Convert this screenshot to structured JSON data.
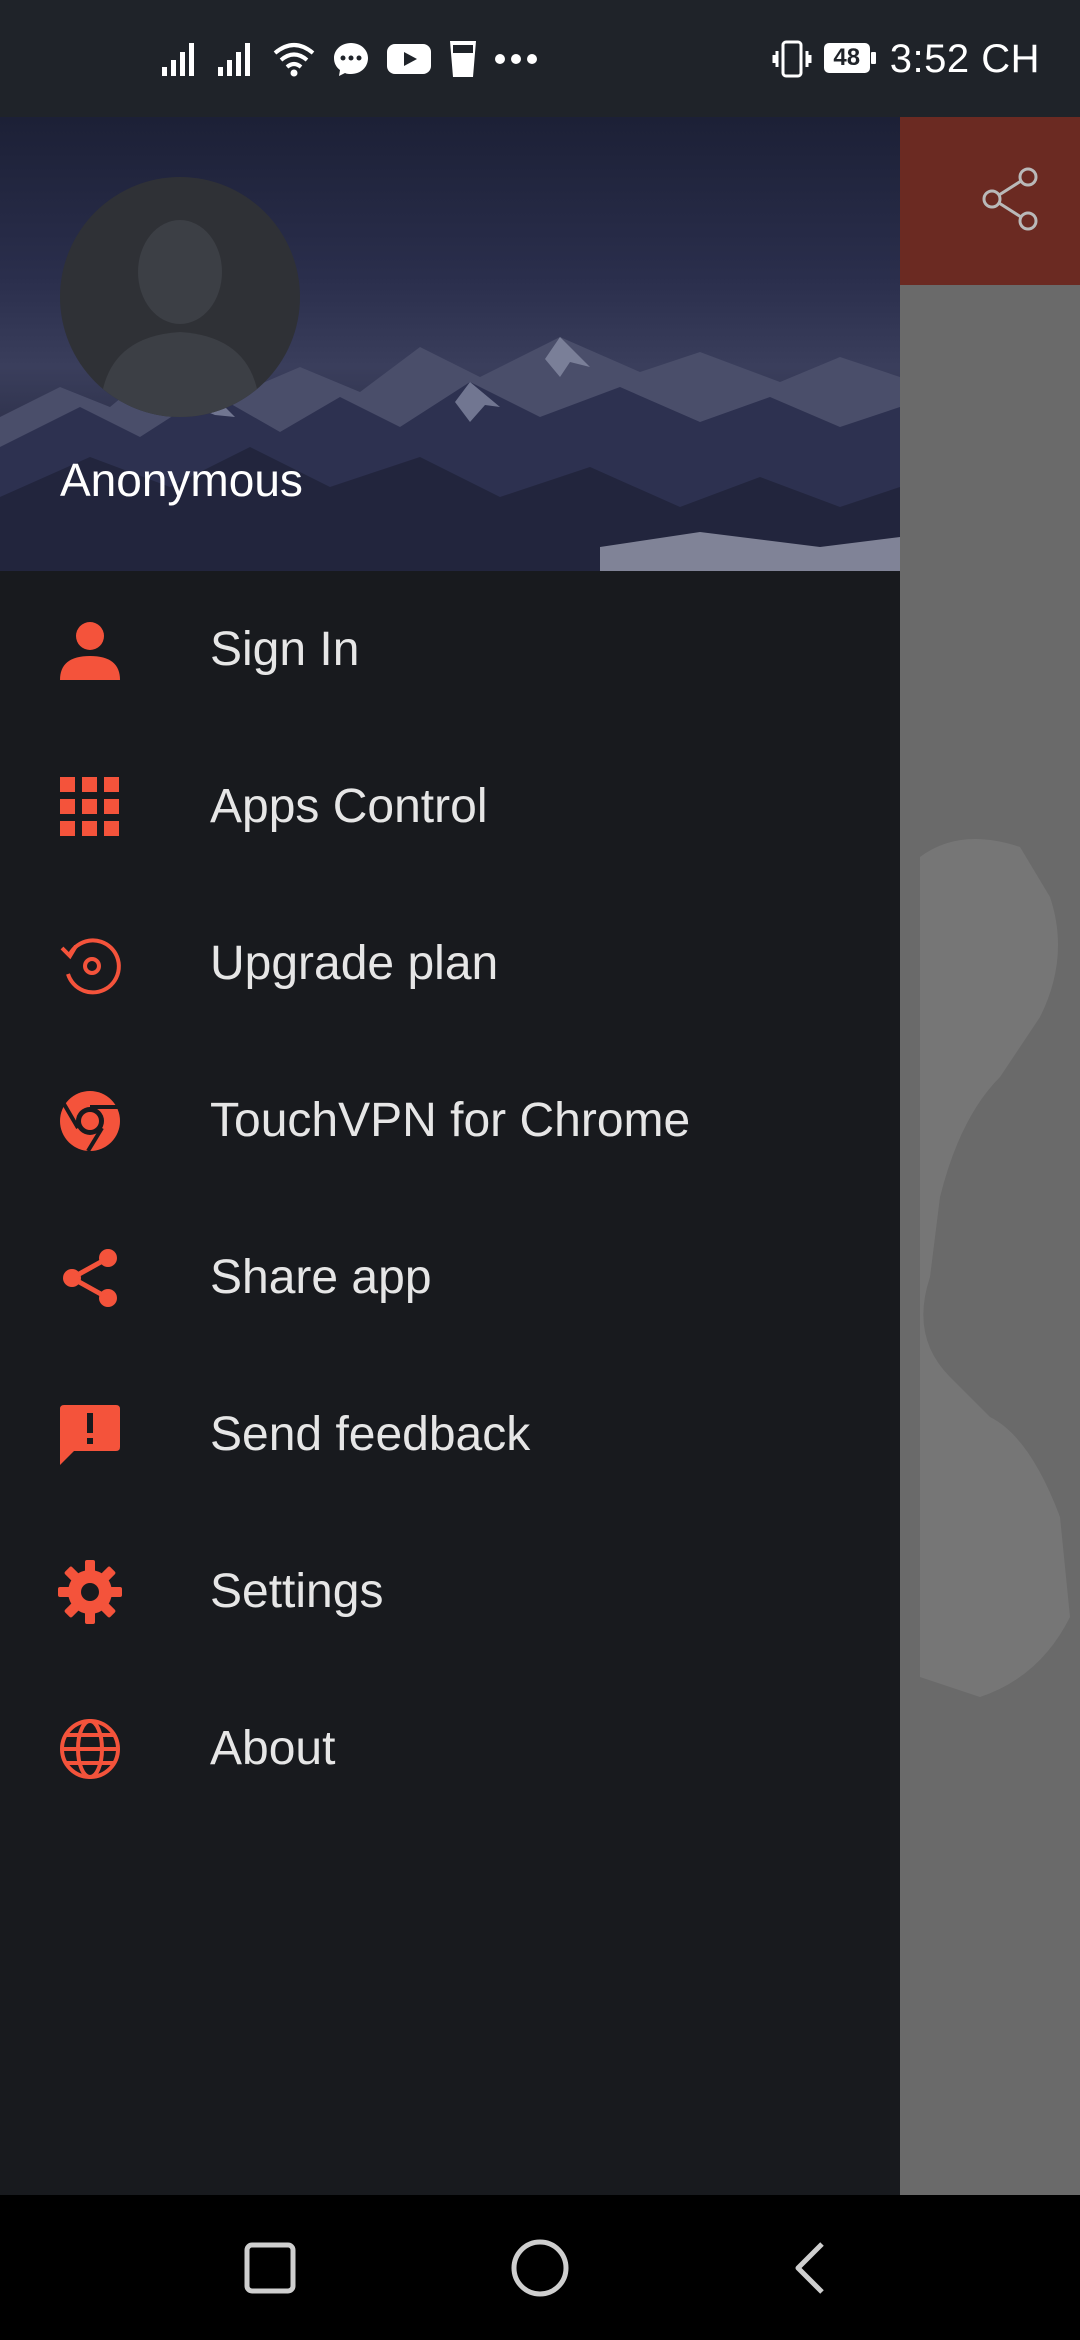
{
  "status_bar": {
    "time": "3:52 CH",
    "battery": "48",
    "icons": [
      "signal-icon",
      "signal-icon",
      "wifi-icon",
      "messenger-icon",
      "youtube-icon",
      "glass-icon",
      "more-dots-icon",
      "vibrate-icon",
      "battery-icon"
    ]
  },
  "drawer": {
    "user_name": "Anonymous",
    "items": [
      {
        "label": "Sign In",
        "icon": "person-icon"
      },
      {
        "label": "Apps Control",
        "icon": "apps-grid-icon"
      },
      {
        "label": "Upgrade plan",
        "icon": "upgrade-icon"
      },
      {
        "label": "TouchVPN for Chrome",
        "icon": "chrome-icon"
      },
      {
        "label": "Share app",
        "icon": "share-icon"
      },
      {
        "label": "Send feedback",
        "icon": "feedback-icon"
      },
      {
        "label": "Settings",
        "icon": "gear-icon"
      },
      {
        "label": "About",
        "icon": "globe-icon"
      }
    ]
  },
  "colors": {
    "accent": "#f4533b",
    "drawer_bg": "#181a1e",
    "toolbar": "#6b2a22"
  },
  "nav_bar": {
    "buttons": [
      "recents-button",
      "home-button",
      "back-button"
    ]
  }
}
